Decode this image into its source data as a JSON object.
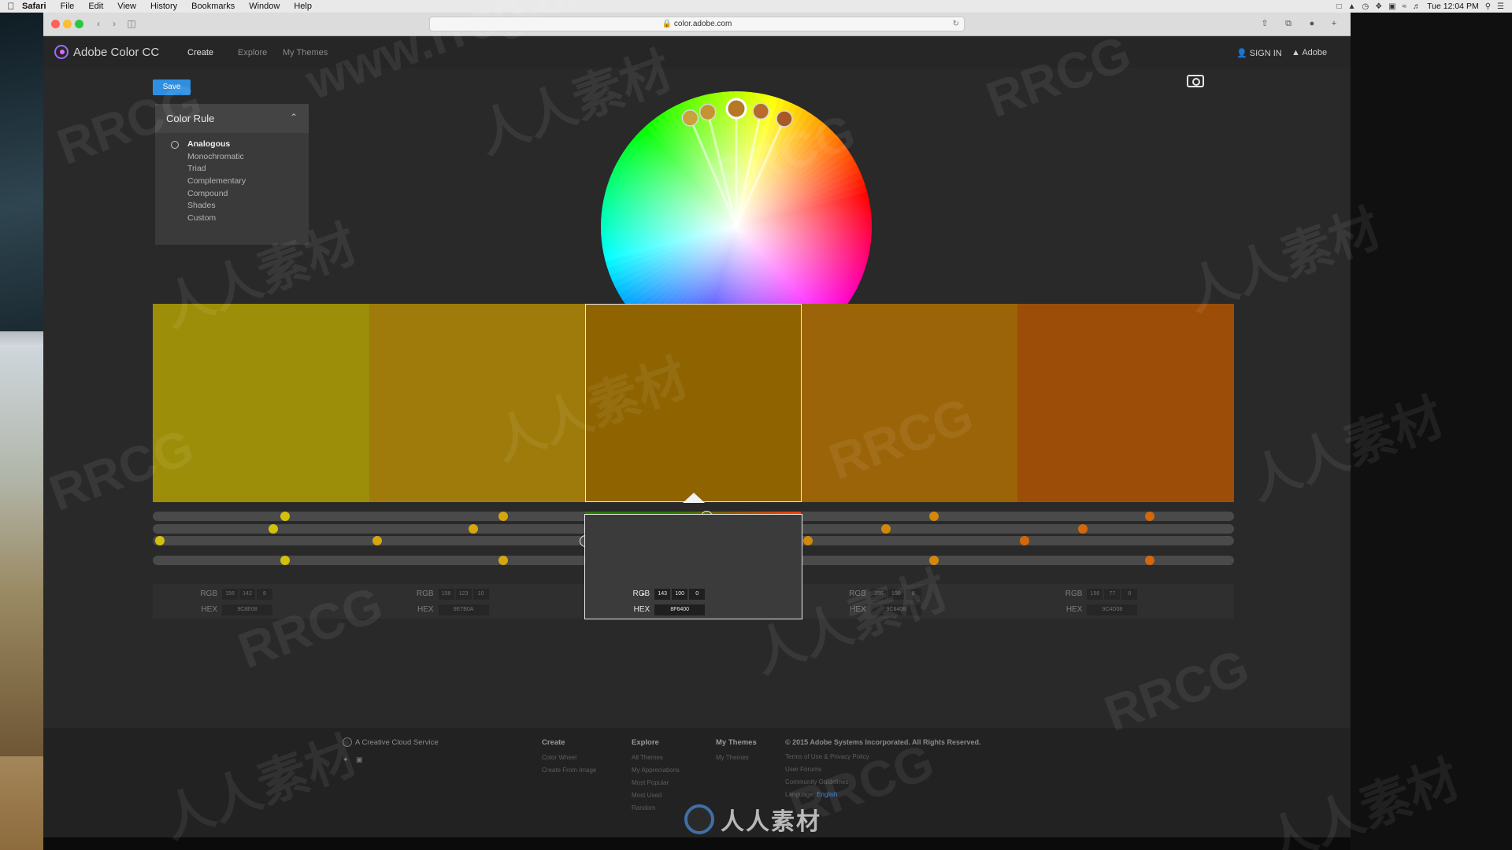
{
  "macos_menubar": {
    "app_name": "Safari",
    "menus": [
      "File",
      "Edit",
      "View",
      "History",
      "Bookmarks",
      "Window",
      "Help"
    ],
    "clock": "Tue 12:04 PM"
  },
  "browser": {
    "url": "color.adobe.com",
    "overlay_watermark": "www.rrcg.cn"
  },
  "app": {
    "name": "Adobe Color CC",
    "nav": [
      "Create",
      "Explore",
      "My Themes"
    ],
    "active_nav": "Create",
    "sign_in": "SIGN IN",
    "adobe": "Adobe",
    "save_label": "Save"
  },
  "color_rule": {
    "title": "Color Rule",
    "options": [
      "Analogous",
      "Monochromatic",
      "Triad",
      "Complementary",
      "Compound",
      "Shades",
      "Custom"
    ],
    "selected": "Analogous"
  },
  "wheel": {
    "marker_colors": [
      "#c8a23a",
      "#c4942e",
      "#b57824",
      "#b96b2a",
      "#a95a24"
    ]
  },
  "swatches": [
    {
      "color": "#9C8E08"
    },
    {
      "color": "#9E7B0A"
    },
    {
      "color": "#8F6400"
    },
    {
      "color": "#9C6408"
    },
    {
      "color": "#9C4D08"
    }
  ],
  "active_swatch": 2,
  "values": [
    {
      "rgb": [
        "156",
        "142",
        "8"
      ],
      "hex": "9C8E08"
    },
    {
      "rgb": [
        "158",
        "123",
        "10"
      ],
      "hex": "9E7B0A"
    },
    {
      "rgb": [
        "143",
        "100",
        "0"
      ],
      "hex": "8F6400"
    },
    {
      "rgb": [
        "156",
        "100",
        "8"
      ],
      "hex": "9C6408"
    },
    {
      "rgb": [
        "156",
        "77",
        "8"
      ],
      "hex": "9C4D08"
    }
  ],
  "labels": {
    "rgb": "RGB",
    "hex": "HEX"
  },
  "footer": {
    "ccs": "A Creative Cloud Service",
    "create_head": "Create",
    "create_links": [
      "Color Wheel",
      "Create From Image"
    ],
    "explore_head": "Explore",
    "explore_links": [
      "All Themes",
      "My Appreciations",
      "Most Popular",
      "Most Used",
      "Random"
    ],
    "themes_head": "My Themes",
    "themes_links": [
      "My Themes"
    ],
    "copyright": "© 2015 Adobe Systems Incorporated. All Rights Reserved.",
    "legal_links": [
      "Terms of Use",
      "&",
      "Privacy Policy"
    ],
    "more_links": [
      "User Forums",
      "Community Guidelines"
    ],
    "language_label": "Language:",
    "language_value": "English"
  },
  "watermark_logo_text": "人人素材",
  "watermarks": [
    "RRCG",
    "人人素材"
  ]
}
